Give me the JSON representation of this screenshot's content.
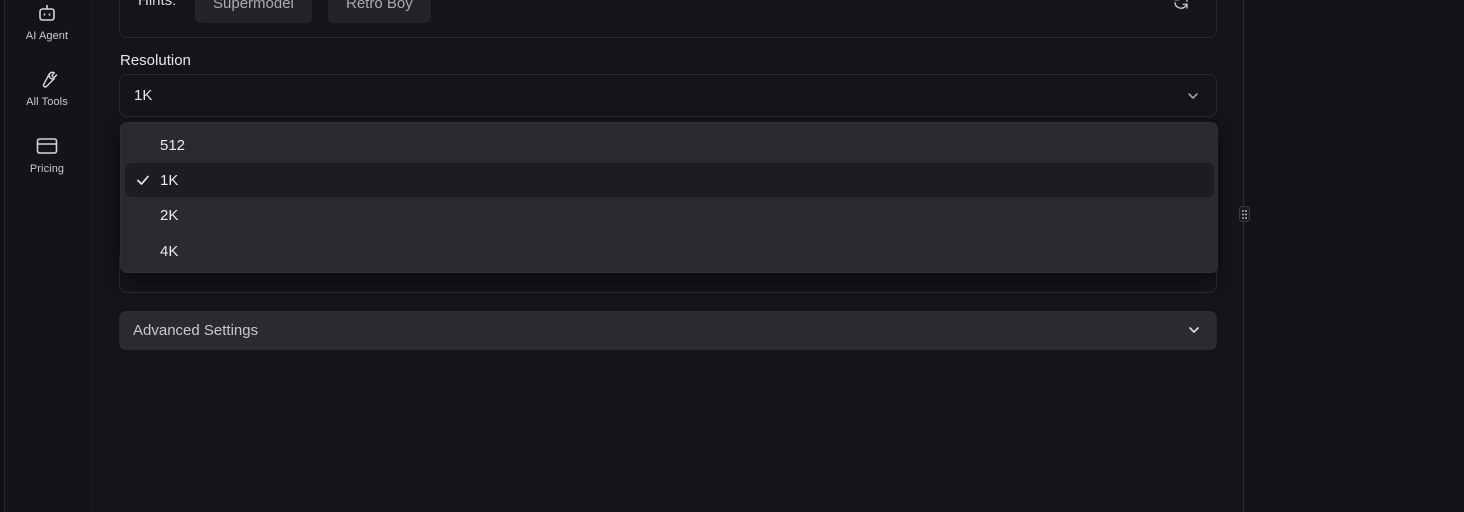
{
  "sidebar": {
    "items": [
      {
        "label": "AI Agent",
        "icon": "robot-icon"
      },
      {
        "label": "All Tools",
        "icon": "wrench-icon"
      },
      {
        "label": "Pricing",
        "icon": "credit-card-icon"
      }
    ]
  },
  "hints": {
    "label": "Hints:",
    "chips": [
      "Supermodel",
      "Retro Boy"
    ]
  },
  "resolution": {
    "label": "Resolution",
    "value": "1K",
    "options": [
      "512",
      "1K",
      "2K",
      "4K"
    ],
    "selected_index": 1
  },
  "advanced": {
    "label": "Advanced Settings"
  },
  "colors": {
    "background": "#141518",
    "dropdown": "#2a2b30",
    "selected_row": "#1c1d21",
    "text": "#e6e7ea"
  }
}
